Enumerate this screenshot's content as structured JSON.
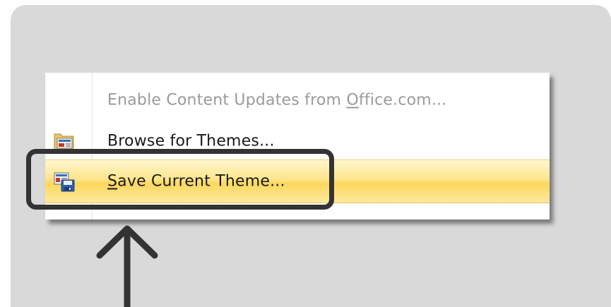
{
  "menu": {
    "items": [
      {
        "before": "Enable Content Updates from ",
        "mnemonic": "O",
        "after": "ffice.com...",
        "enabled": false
      },
      {
        "before": "Browse for Themes...",
        "mnemonic": "",
        "after": "",
        "enabled": true
      },
      {
        "before": "",
        "mnemonic": "S",
        "after": "ave Current Theme...",
        "enabled": true,
        "highlighted": true
      }
    ]
  },
  "colors": {
    "background": "#d9d9d9",
    "highlight": "#fde58c",
    "disabled_text": "#9a9a9a",
    "callout": "#333333"
  },
  "icons": {
    "browse": "browse-themes-icon",
    "save": "save-theme-icon",
    "arrow": "up-arrow-icon"
  }
}
